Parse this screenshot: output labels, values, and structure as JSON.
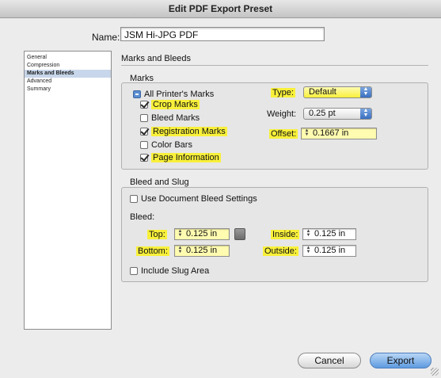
{
  "window": {
    "title": "Edit PDF Export Preset"
  },
  "name_field": {
    "label": "Name:",
    "value": "JSM Hi-JPG PDF"
  },
  "sidebar": {
    "items": [
      {
        "label": "General"
      },
      {
        "label": "Compression"
      },
      {
        "label": "Marks and Bleeds"
      },
      {
        "label": "Advanced"
      },
      {
        "label": "Summary"
      }
    ]
  },
  "section": {
    "title": "Marks and Bleeds"
  },
  "marks": {
    "title": "Marks",
    "all_printers_marks": "All Printer's Marks",
    "crop_marks": "Crop Marks",
    "bleed_marks": "Bleed Marks",
    "registration_marks": "Registration Marks",
    "color_bars": "Color Bars",
    "page_information": "Page Information",
    "type_label": "Type:",
    "type_value": "Default",
    "weight_label": "Weight:",
    "weight_value": "0.25 pt",
    "offset_label": "Offset:",
    "offset_value": "0.1667 in"
  },
  "bleed_slug": {
    "title": "Bleed and Slug",
    "use_document_bleed": "Use Document Bleed Settings",
    "bleed_label": "Bleed:",
    "top_label": "Top:",
    "top_value": "0.125 in",
    "bottom_label": "Bottom:",
    "bottom_value": "0.125 in",
    "inside_label": "Inside:",
    "inside_value": "0.125 in",
    "outside_label": "Outside:",
    "outside_value": "0.125 in",
    "include_slug": "Include Slug Area"
  },
  "buttons": {
    "cancel": "Cancel",
    "export": "Export"
  },
  "colors": {
    "highlight": "#f8f03a",
    "selection": "#c7d6ea",
    "primary_button": "#5f9be0"
  }
}
